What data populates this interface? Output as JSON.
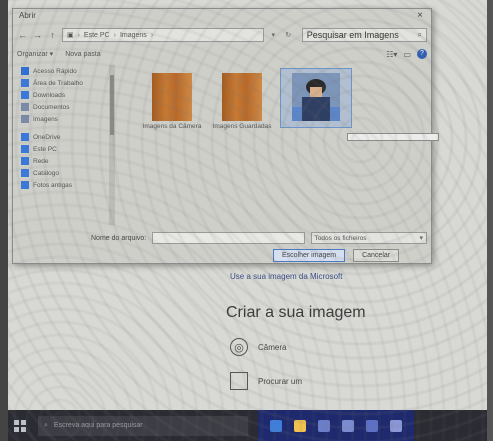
{
  "dialog": {
    "title": "Abrir",
    "close_label": "×",
    "address": {
      "crumbs": [
        "Este PC",
        "Imagens"
      ]
    },
    "search_placeholder": "Pesquisar em Imagens",
    "toolbar": {
      "organize_label": "Organizar ▾",
      "new_folder_label": "Nova pasta"
    },
    "nav_items": [
      {
        "label": "Acesso Rápido",
        "icon": "star-icon",
        "color": "#2f6fd4"
      },
      {
        "label": "Área de Trabalho",
        "icon": "desktop-icon",
        "color": "#3b78d8"
      },
      {
        "label": "Downloads",
        "icon": "download-icon",
        "color": "#3b78d8"
      },
      {
        "label": "Documentos",
        "icon": "documents-icon",
        "color": "#7a8aa8"
      },
      {
        "label": "Imagens",
        "icon": "pictures-icon",
        "color": "#7a8aa8"
      },
      {
        "label": "OneDrive",
        "icon": "onedrive-icon",
        "color": "#3b78d8"
      },
      {
        "label": "Este PC",
        "icon": "this-pc-icon",
        "color": "#3b78d8"
      },
      {
        "label": "Rede",
        "icon": "network-icon",
        "color": "#3b78d8"
      },
      {
        "label": "Catálogo",
        "icon": "folder-icon",
        "color": "#3b78d8"
      },
      {
        "label": "Fotos antigas",
        "icon": "folder-icon",
        "color": "#3b78d8"
      }
    ],
    "files": [
      {
        "label": "Imagens da Câmera"
      },
      {
        "label": "Imagens Guardadas"
      },
      {
        "label": ""
      }
    ],
    "filename_label": "Nome do arquivo:",
    "filter_value": "Todos os ficheiros",
    "open_button": "Escolher imagem",
    "cancel_button": "Cancelar"
  },
  "webpage": {
    "link_text": "Use a sua imagem da Microsoft",
    "heading": "Criar a sua imagem",
    "option_camera": "Câmera",
    "option_browse": "Procurar um"
  },
  "taskbar": {
    "search_placeholder": "Escreva aqui para pesquisar",
    "pinned": [
      {
        "name": "edge-icon",
        "color": "#3d7edb"
      },
      {
        "name": "explorer-icon",
        "color": "#f1c24d"
      },
      {
        "name": "store-icon",
        "color": "#6b7fc9"
      },
      {
        "name": "mail-icon",
        "color": "#7b8bd0"
      },
      {
        "name": "app-icon",
        "color": "#5c6fc4"
      },
      {
        "name": "settings-icon",
        "color": "#8b96d6"
      }
    ]
  }
}
